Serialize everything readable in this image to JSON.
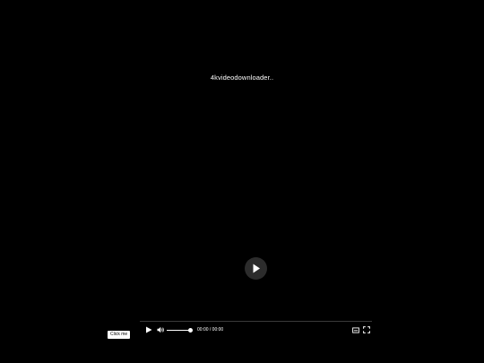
{
  "video": {
    "title": "4kvideodownloader.."
  },
  "controls": {
    "time": "00:00 / 00:00",
    "volume_level": 1.0,
    "play_icon": "play-icon",
    "volume_icon": "volume-icon",
    "captions_icon": "captions-icon",
    "fullscreen_icon": "fullscreen-icon"
  },
  "tooltip": {
    "text": "Click me"
  },
  "colors": {
    "background": "#000000",
    "text": "#ffffff",
    "big_play_bg": "#2c2c2c"
  }
}
